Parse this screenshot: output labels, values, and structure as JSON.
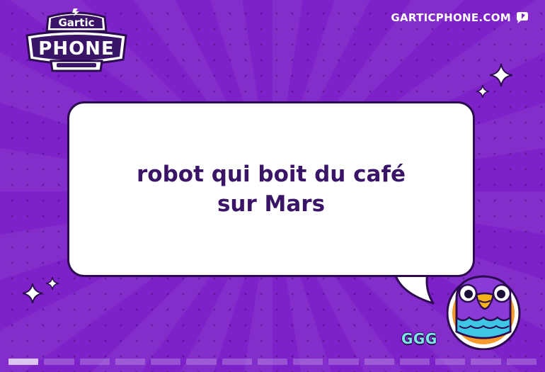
{
  "header": {
    "logo": {
      "top_text": "Gartic",
      "main_text": "PHONE",
      "icon": "gartic-phone-logo"
    },
    "site_link": {
      "label": "GARTICPHONE.COM",
      "icon": "speech-bubble-icon"
    }
  },
  "prompt": {
    "text": "robot qui boit du café sur Mars"
  },
  "player": {
    "name": "GGG",
    "avatar_icon": "bird-avatar"
  },
  "progress": {
    "total_steps": 15,
    "current_step": 1
  },
  "colors": {
    "background": "#7c22c8",
    "bubble": "#ffffff",
    "prompt_text": "#3a1466",
    "player_name": "#7ee6e6"
  }
}
